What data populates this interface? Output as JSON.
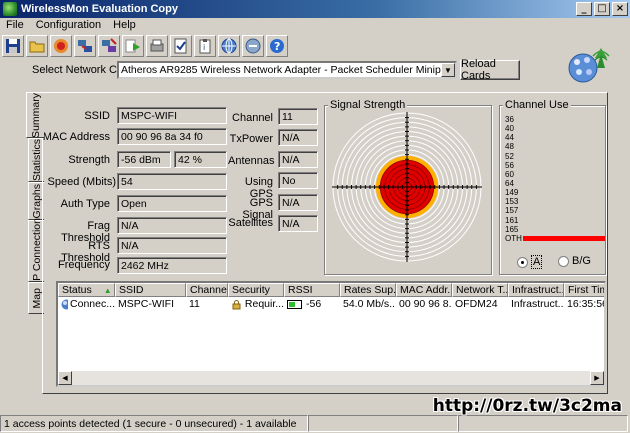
{
  "window": {
    "title": "WirelessMon Evaluation Copy",
    "controls": {
      "minimize": "_",
      "maximize": "□",
      "close": "×"
    }
  },
  "menu": {
    "file": "File",
    "configuration": "Configuration",
    "help": "Help"
  },
  "toolbar": {
    "icons": [
      "save-icon",
      "open-folder-icon",
      "record-icon",
      "network-icon",
      "network-delete-icon",
      "play-icon",
      "print-icon",
      "checklist-icon",
      "clipboard-icon",
      "globe-icon",
      "connect-icon",
      "help-icon"
    ]
  },
  "network_card": {
    "label": "Select Network Card",
    "selected": "Atheros AR9285 Wireless Network Adapter - Packet Scheduler Miniport",
    "reload_label": "Reload Cards"
  },
  "tabs": [
    "Summary",
    "Statistics",
    "Graphs",
    "IP Connection",
    "Map"
  ],
  "summary": {
    "ssid_label": "SSID",
    "ssid": "MSPC-WIFI",
    "mac_label": "MAC Address",
    "mac": "00 90 96 8a 34 f0",
    "strength_label": "Strength",
    "strength_dbm": "-56 dBm",
    "strength_pct": "42 %",
    "speed_label": "Speed (Mbits)",
    "speed": "54",
    "auth_label": "Auth Type",
    "auth": "Open",
    "frag_label": "Frag Threshold",
    "frag": "N/A",
    "rts_label": "RTS Threshold",
    "rts": "N/A",
    "freq_label": "Frequency",
    "freq": "2462 MHz",
    "channel_label": "Channel",
    "channel": "11",
    "txpower_label": "TxPower",
    "txpower": "N/A",
    "antennas_label": "Antennas",
    "antennas": "N/A",
    "gps_label": "Using GPS",
    "gps": "No",
    "gps_signal_label": "GPS Signal",
    "gps_signal": "N/A",
    "satellites_label": "Satellites",
    "satellites": "N/A"
  },
  "signal_strength": {
    "title": "Signal Strength",
    "level_pct": 42
  },
  "channel_use": {
    "title": "Channel Use",
    "channels": [
      "36",
      "40",
      "44",
      "48",
      "52",
      "56",
      "60",
      "64",
      "149",
      "153",
      "157",
      "161",
      "165",
      "OTH"
    ],
    "bar_channel": "OTH",
    "bar_color": "#ff0000",
    "radio_a": "A",
    "radio_bg": "B/G",
    "selected": "A"
  },
  "ap_list": {
    "columns": [
      "Status",
      "SSID",
      "Channel",
      "Security",
      "RSSI",
      "Rates Sup...",
      "MAC Addr...",
      "Network T...",
      "Infrastruct...",
      "First Tim"
    ],
    "rows": [
      [
        "Connec...",
        "MSPC-WIFI",
        "11",
        "Requir...",
        "-56",
        "54.0 Mb/s...",
        "00 90 96 8...",
        "OFDM24",
        "Infrastruct...",
        "16:35:56"
      ]
    ]
  },
  "status_bar": {
    "text": "1 access points detected (1 secure - 0 unsecured) - 1 available"
  },
  "watermark": "http://0rz.tw/3c2ma"
}
